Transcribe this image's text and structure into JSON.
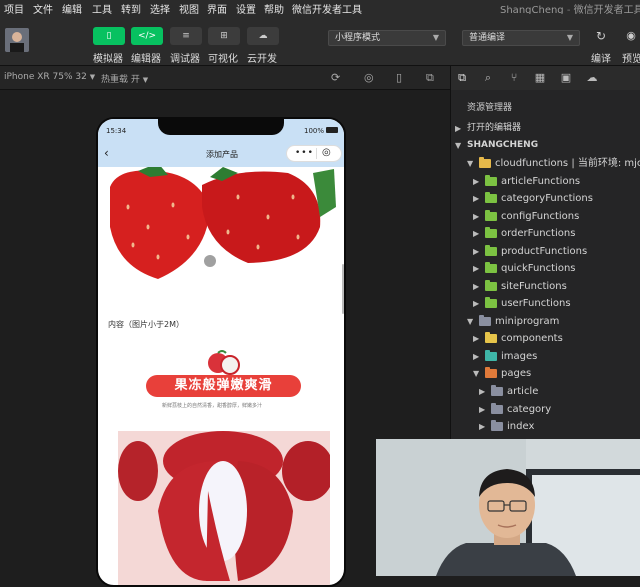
{
  "menu": [
    "项目",
    "文件",
    "编辑",
    "工具",
    "转到",
    "选择",
    "视图",
    "界面",
    "设置",
    "帮助",
    "微信开发者工具"
  ],
  "window_title": {
    "user": "ShangCheng",
    "app": "微信开发者工具"
  },
  "toolbar": {
    "simulator": "模拟器",
    "editor": "编辑器",
    "debugger": "调试器",
    "visual": "可视化",
    "cloud": "云开发",
    "mode_select": "小程序模式",
    "compile_select": "普通编译",
    "compile_btn": "编译",
    "preview_btn": "预览"
  },
  "subbar": {
    "device": "iPhone XR 75% 32",
    "hot_reload": "热重载 开"
  },
  "explorer": {
    "title": "资源管理器",
    "open_editors": "打开的编辑器",
    "project": "SHANGCHENG",
    "cloudfunctions": "cloudfunctions | 当前环境: mjcl",
    "items": [
      "articleFunctions",
      "categoryFunctions",
      "configFunctions",
      "orderFunctions",
      "productFunctions",
      "quickFunctions",
      "siteFunctions",
      "userFunctions"
    ],
    "miniprogram": "miniprogram",
    "components": "components",
    "images": "images",
    "pages": "pages",
    "page_items": [
      "article",
      "category",
      "index"
    ]
  },
  "phone": {
    "time": "15:34",
    "battery": "100%",
    "nav_title": "添加产品",
    "content_label": "内容（图片小于2M）",
    "banner_title": "果冻般弹嫩爽滑",
    "banner_sub": "新鲜荔枝上的自然清香，甜香醇厚，鲜嫩多汁"
  },
  "colors": {
    "accent_green": "#07c160",
    "banner_red": "#e8403a",
    "nav_bg": "#c9e0f5"
  }
}
